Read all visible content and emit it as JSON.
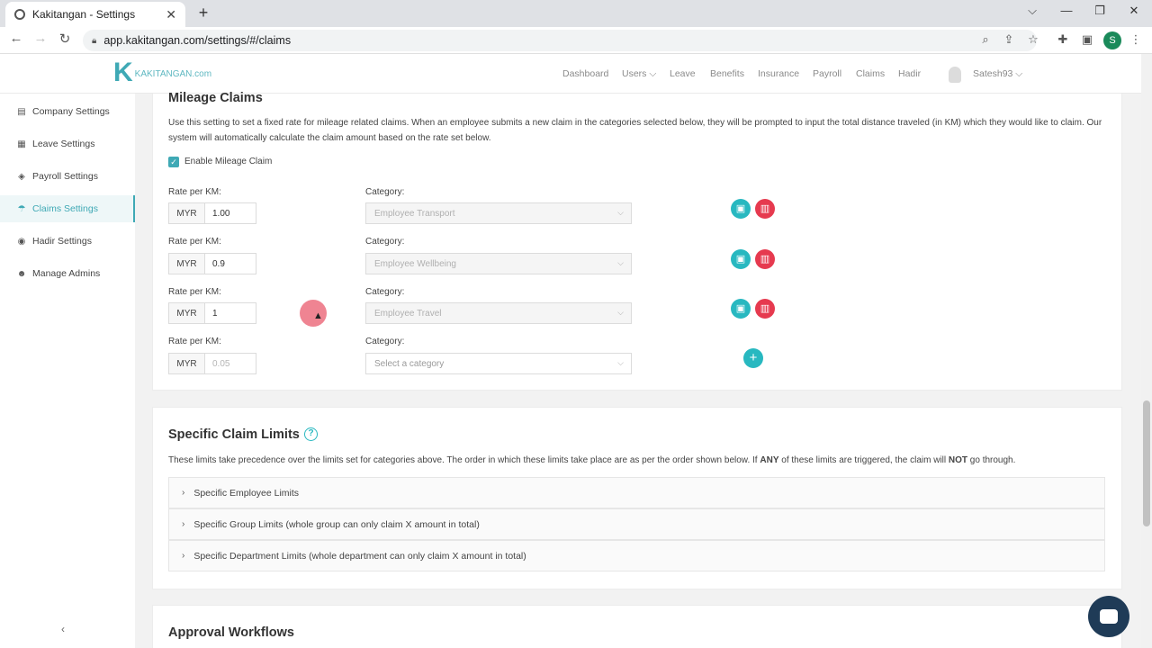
{
  "browser": {
    "tab_title": "Kakitangan - Settings",
    "url": "app.kakitangan.com/settings/#/claims",
    "profile_initial": "S",
    "new_tab": "+",
    "close_tab": "✕"
  },
  "header": {
    "logo_letter": "K",
    "logo_text": "KAKITANGAN.com",
    "nav": [
      "Dashboard",
      "Users ⌵",
      "Leave",
      "Benefits",
      "Insurance",
      "Payroll",
      "Claims",
      "Hadir"
    ],
    "user": "Satesh93 ⌵"
  },
  "sidebar": {
    "items": [
      {
        "label": "Company Settings",
        "icon": "▤"
      },
      {
        "label": "Leave Settings",
        "icon": "▦"
      },
      {
        "label": "Payroll Settings",
        "icon": "◈"
      },
      {
        "label": "Claims Settings",
        "icon": "☂"
      },
      {
        "label": "Hadir Settings",
        "icon": "◉"
      },
      {
        "label": "Manage Admins",
        "icon": "☻"
      }
    ],
    "collapse": "‹"
  },
  "mileage": {
    "title": "Mileage Claims",
    "description": "Use this setting to set a fixed rate for mileage related claims. When an employee submits a new claim in the categories selected below, they will be prompted to input the total distance traveled (in KM) which they would like to claim. Our system will automatically calculate the claim amount based on the rate set below.",
    "enable_label": "Enable Mileage Claim",
    "rate_label": "Rate per KM:",
    "category_label": "Category:",
    "currency": "MYR",
    "rows": [
      {
        "rate": "1.00",
        "category": "Employee Transport"
      },
      {
        "rate": "0.9",
        "category": "Employee Wellbeing"
      },
      {
        "rate": "1",
        "category": "Employee Travel"
      }
    ],
    "new_rate_placeholder": "0.05",
    "new_category_placeholder": "Select a category"
  },
  "limits": {
    "title": "Specific Claim Limits",
    "desc_part1": "These limits take precedence over the limits set for categories above. The order in which these limits take place are as per the order shown below. If ",
    "desc_bold1": "ANY",
    "desc_part2": " of these limits are triggered, the claim will ",
    "desc_bold2": "NOT",
    "desc_part3": " go through.",
    "accordions": [
      "Specific Employee Limits",
      "Specific Group Limits (whole group can only claim X amount in total)",
      "Specific Department Limits (whole department can only claim X amount in total)"
    ]
  },
  "approval": {
    "title": "Approval Workflows"
  },
  "colors": {
    "accent": "#3fa9b5",
    "save": "#28b8c0",
    "delete": "#e63a4f"
  }
}
